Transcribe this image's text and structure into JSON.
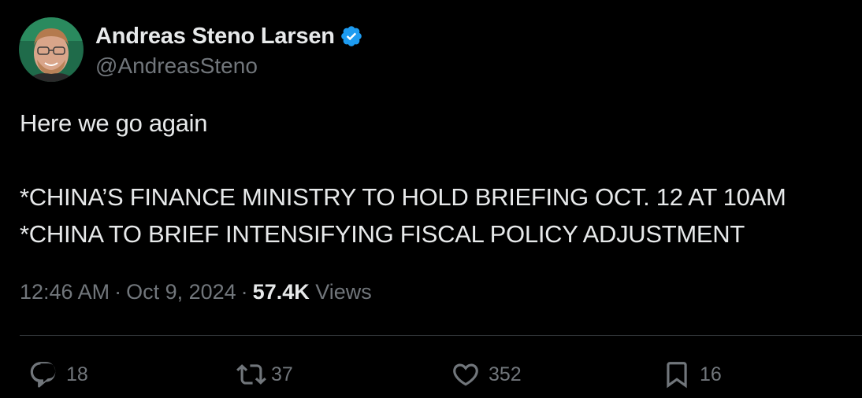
{
  "author": {
    "display_name": "Andreas Steno Larsen",
    "handle": "@AndreasSteno",
    "verified": true,
    "verified_color": "#1d9bf0"
  },
  "tweet": {
    "lines": [
      "Here we go again",
      "",
      "*CHINA’S FINANCE MINISTRY TO HOLD BRIEFING OCT. 12 AT 10AM",
      "*CHINA TO BRIEF INTENSIFYING FISCAL POLICY ADJUSTMENT"
    ]
  },
  "meta": {
    "time": "12:46 AM",
    "date": "Oct 9, 2024",
    "separator": "·",
    "views_count": "57.4K",
    "views_label": "Views"
  },
  "actions": {
    "reply": {
      "icon": "reply-icon",
      "count": "18"
    },
    "repost": {
      "icon": "repost-icon",
      "count": "37"
    },
    "like": {
      "icon": "heart-icon",
      "count": "352"
    },
    "bookmark": {
      "icon": "bookmark-icon",
      "count": "16"
    }
  },
  "colors": {
    "background": "#000000",
    "text_primary": "#e7e9ea",
    "text_secondary": "#71767b",
    "divider": "#2f3336"
  }
}
